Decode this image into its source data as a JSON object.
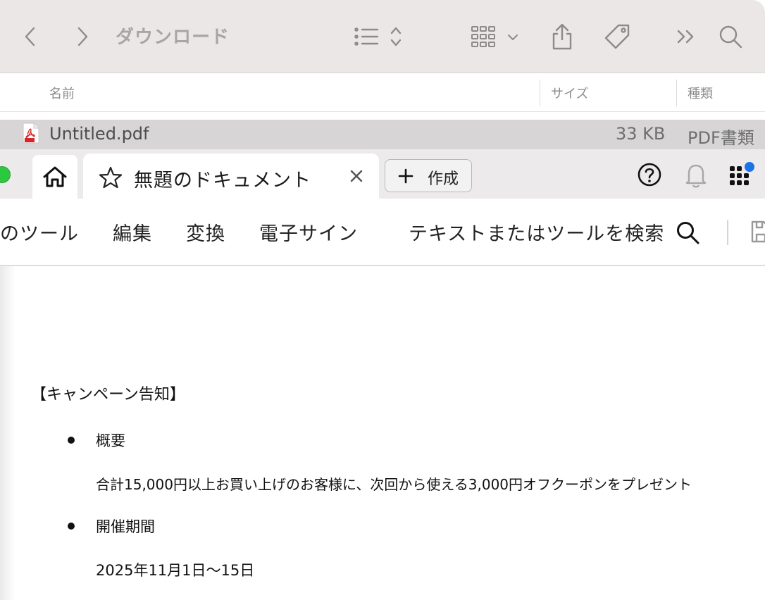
{
  "finder": {
    "title": "ダウンロード",
    "columns": {
      "name": "名前",
      "size": "サイズ",
      "kind": "種類"
    },
    "file": {
      "name": "Untitled.pdf",
      "size": "33 KB",
      "kind": "PDF書類",
      "icon": "pdf-file-icon"
    }
  },
  "acrobat": {
    "tabs": {
      "home_icon": "home-icon",
      "doc_title": "無題のドキュメント"
    },
    "create_label": "作成",
    "menu": [
      "のツール",
      "編集",
      "変換",
      "電子サイン"
    ],
    "search_hint": "テキストまたはツールを検索",
    "colors": {
      "accent_dot": "#1b73e8",
      "traffic_green": "#2bc840"
    }
  },
  "document": {
    "heading": "【キャンペーン告知】",
    "bullets": [
      {
        "label": "概要",
        "detail": "合計15,000円以上お買い上げのお客様に、次回から使える3,000円オフクーポンをプレゼント"
      },
      {
        "label": "開催期間",
        "detail": "2025年11月1日〜15日"
      }
    ]
  }
}
